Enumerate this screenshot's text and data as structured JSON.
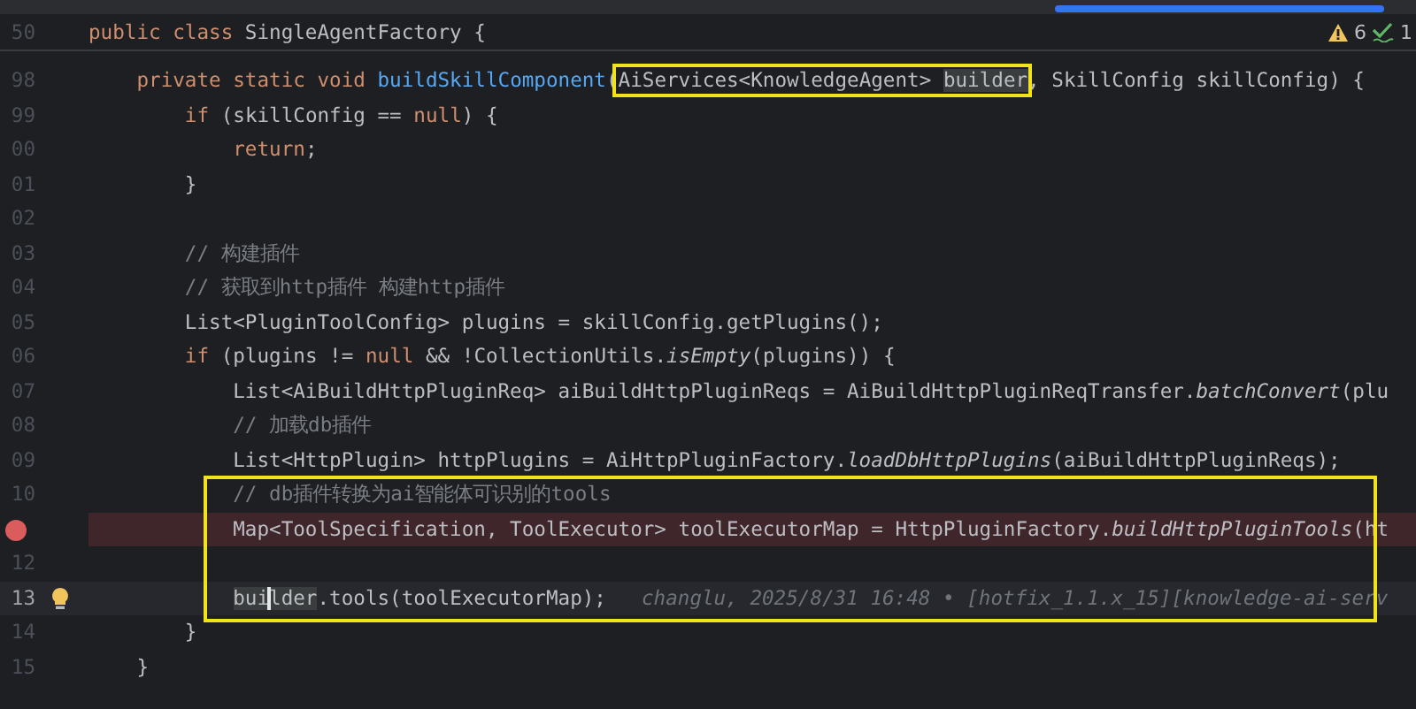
{
  "status": {
    "warnings": "6",
    "checks": "1"
  },
  "sticky_line": {
    "number": "50",
    "tokens": [
      {
        "text": "public class ",
        "kind": "keyword"
      },
      {
        "text": "SingleAgentFactory {",
        "kind": "plain"
      }
    ]
  },
  "lines": [
    {
      "number": "98",
      "tokens": [
        {
          "text": "    private static void ",
          "kind": "keyword"
        },
        {
          "text": "buildSkillComponent",
          "kind": "declaration"
        },
        {
          "text": "(",
          "kind": "plain"
        },
        {
          "text": "AiServices<KnowledgeAgent> ",
          "kind": "plain",
          "boxed": true
        },
        {
          "text": "builder",
          "kind": "plain",
          "boxed": true,
          "highlight": true
        },
        {
          "text": ", SkillConfig skillConfig) {",
          "kind": "plain"
        }
      ]
    },
    {
      "number": "99",
      "tokens": [
        {
          "text": "        if",
          "kind": "keyword"
        },
        {
          "text": " (skillConfig == ",
          "kind": "plain"
        },
        {
          "text": "null",
          "kind": "keyword"
        },
        {
          "text": ") {",
          "kind": "plain"
        }
      ]
    },
    {
      "number": "00",
      "tokens": [
        {
          "text": "            return",
          "kind": "keyword"
        },
        {
          "text": ";",
          "kind": "plain"
        }
      ]
    },
    {
      "number": "01",
      "tokens": [
        {
          "text": "        }",
          "kind": "plain"
        }
      ]
    },
    {
      "number": "02"
    },
    {
      "number": "03",
      "tokens": [
        {
          "text": "        // 构建插件",
          "kind": "comment"
        }
      ]
    },
    {
      "number": "04",
      "tokens": [
        {
          "text": "        // 获取到http插件 构建http插件",
          "kind": "comment"
        }
      ]
    },
    {
      "number": "05",
      "tokens": [
        {
          "text": "        List<PluginToolConfig> plugins = skillConfig.getPlugins();",
          "kind": "plain"
        }
      ]
    },
    {
      "number": "06",
      "tokens": [
        {
          "text": "        if",
          "kind": "keyword"
        },
        {
          "text": " (plugins != ",
          "kind": "plain"
        },
        {
          "text": "null",
          "kind": "keyword"
        },
        {
          "text": " && !CollectionUtils.",
          "kind": "plain"
        },
        {
          "text": "isEmpty",
          "kind": "static"
        },
        {
          "text": "(plugins)) {",
          "kind": "plain"
        }
      ]
    },
    {
      "number": "07",
      "tokens": [
        {
          "text": "            List<AiBuildHttpPluginReq> aiBuildHttpPluginReqs = AiBuildHttpPluginReqTransfer.",
          "kind": "plain"
        },
        {
          "text": "batchConvert",
          "kind": "static"
        },
        {
          "text": "(plu",
          "kind": "plain"
        }
      ]
    },
    {
      "number": "08",
      "tokens": [
        {
          "text": "            // 加载db插件",
          "kind": "comment"
        }
      ]
    },
    {
      "number": "09",
      "tokens": [
        {
          "text": "            List<HttpPlugin> httpPlugins = AiHttpPluginFactory.",
          "kind": "plain"
        },
        {
          "text": "loadDbHttpPlugins",
          "kind": "static"
        },
        {
          "text": "(aiBuildHttpPluginReqs);",
          "kind": "plain"
        }
      ]
    },
    {
      "number": "10",
      "block_boxed": true,
      "tokens": [
        {
          "text": "            // db插件转换为ai智能体可识别的tools",
          "kind": "comment"
        }
      ]
    },
    {
      "breakpoint": true,
      "block_boxed": true,
      "tokens": [
        {
          "text": "            Map<ToolSpecification, ToolExecutor> toolExecutorMap = HttpPluginFactory.",
          "kind": "plain"
        },
        {
          "text": "buildHttpPluginTools",
          "kind": "static"
        },
        {
          "text": "(ht",
          "kind": "plain"
        }
      ]
    },
    {
      "number": "12",
      "block_boxed": true
    },
    {
      "number": "13",
      "current": true,
      "bulb": true,
      "block_boxed": true,
      "tokens": [
        {
          "text": "            bui",
          "kind": "plain",
          "highlight": true
        },
        {
          "text": "lder",
          "kind": "plain",
          "highlight": true,
          "caret": true
        },
        {
          "text": ".tools(toolExecutorMap);",
          "kind": "plain"
        }
      ],
      "blame": "changlu, 2025/8/31 16:48 • [hotfix_1.1.x_15][knowledge-ai-serv"
    },
    {
      "number": "14",
      "tokens": [
        {
          "text": "        }",
          "kind": "plain"
        }
      ]
    },
    {
      "number": "15",
      "tokens": [
        {
          "text": "    }",
          "kind": "plain"
        }
      ]
    }
  ]
}
